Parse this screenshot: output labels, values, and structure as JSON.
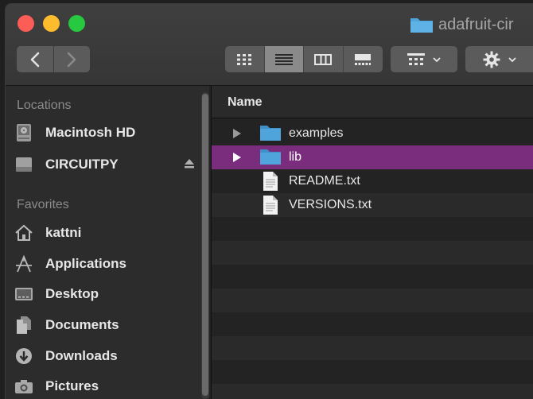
{
  "window": {
    "title": "adafruit-cir"
  },
  "toolbar": {
    "back_icon": "chevron-left-icon",
    "forward_icon": "chevron-right-icon",
    "view_modes": [
      {
        "name": "icon-view-icon",
        "active": false
      },
      {
        "name": "list-view-icon",
        "active": true
      },
      {
        "name": "column-view-icon",
        "active": false
      },
      {
        "name": "gallery-view-icon",
        "active": false
      }
    ],
    "group_icon": "group-grid-icon",
    "action_icon": "gear-icon"
  },
  "sidebar": {
    "locations_header": "Locations",
    "locations": [
      {
        "label": "Macintosh HD",
        "icon": "hard-drive-icon"
      },
      {
        "label": "CIRCUITPY",
        "icon": "external-drive-icon",
        "eject": true
      }
    ],
    "favorites_header": "Favorites",
    "favorites": [
      {
        "label": "kattni",
        "icon": "home-icon"
      },
      {
        "label": "Applications",
        "icon": "applications-icon"
      },
      {
        "label": "Desktop",
        "icon": "desktop-icon"
      },
      {
        "label": "Documents",
        "icon": "documents-icon"
      },
      {
        "label": "Downloads",
        "icon": "downloads-icon"
      },
      {
        "label": "Pictures",
        "icon": "camera-icon"
      }
    ]
  },
  "list": {
    "column_name": "Name",
    "rows": [
      {
        "label": "examples",
        "type": "folder",
        "selected": false
      },
      {
        "label": "lib",
        "type": "folder",
        "selected": true
      },
      {
        "label": "README.txt",
        "type": "file",
        "selected": false
      },
      {
        "label": "VERSIONS.txt",
        "type": "file",
        "selected": false
      }
    ]
  },
  "colors": {
    "selection": "#792d7c",
    "folder": "#4fa4dc",
    "close": "#fc5d56",
    "minimize": "#fdbb2e",
    "maximize": "#26c940"
  }
}
